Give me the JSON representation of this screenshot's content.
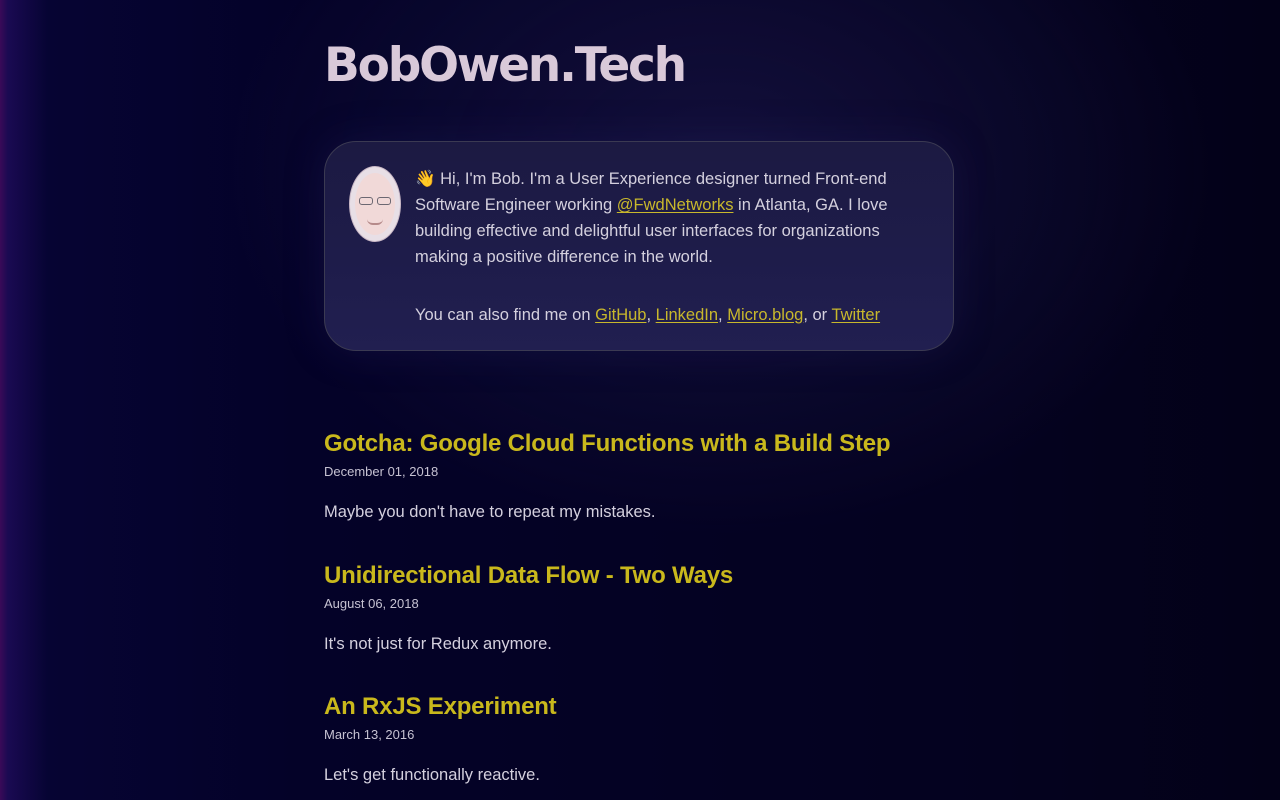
{
  "site": {
    "title": "BobOwen.Tech"
  },
  "intro": {
    "avatar_alt": "Bob Owen avatar",
    "wave_emoji": "👋",
    "greeting": " Hi, I'm Bob. I'm a User Experience designer turned Front-end Software Engineer working ",
    "company_link": "@FwdNetworks",
    "after_company": " in Atlanta, GA. I love building effective and delightful user interfaces for organizations making a positive difference in the world.",
    "find_me_prefix": "You can also find me on ",
    "links": {
      "github": "GitHub",
      "linkedin": "LinkedIn",
      "microblog": "Micro.blog",
      "twitter": "Twitter"
    },
    "sep1": ", ",
    "sep2": ", ",
    "sep3": ", or "
  },
  "posts": [
    {
      "title": "Gotcha: Google Cloud Functions with a Build Step",
      "date": "December 01, 2018",
      "summary": "Maybe you don't have to repeat my mistakes."
    },
    {
      "title": "Unidirectional Data Flow - Two Ways",
      "date": "August 06, 2018",
      "summary": "It's not just for Redux anymore."
    },
    {
      "title": "An RxJS Experiment",
      "date": "March 13, 2016",
      "summary": "Let's get functionally reactive."
    }
  ],
  "colors": {
    "accent": "#c9b81c",
    "title": "#d9c9d9",
    "background": "#040228"
  }
}
